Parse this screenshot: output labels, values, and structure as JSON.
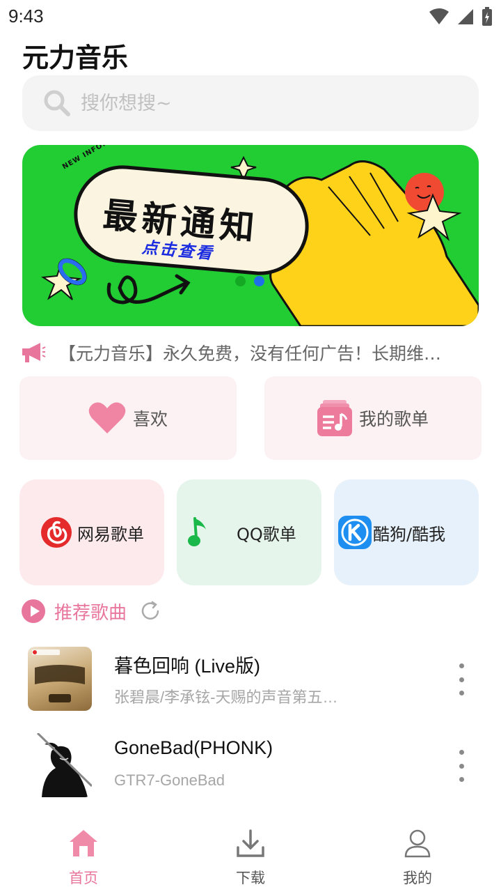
{
  "status_bar": {
    "time": "9:43"
  },
  "app": {
    "title": "元力音乐"
  },
  "search": {
    "placeholder": "搜你想搜~"
  },
  "banner": {
    "tag": "NEW INFORMARTION",
    "title": "最新通知",
    "subtitle": "点击查看",
    "dots": 2,
    "active_dot": 2
  },
  "notice": {
    "text": "【元力音乐】永久免费，没有任何广告！长期维…"
  },
  "quick_cards": [
    {
      "label": "喜欢",
      "icon": "heart-icon"
    },
    {
      "label": "我的歌单",
      "icon": "playlist-icon"
    }
  ],
  "platform_cards": [
    {
      "label": "网易歌单",
      "icon": "netease-icon",
      "bg": "#fdeaed"
    },
    {
      "label": "QQ歌单",
      "icon": "qq-music-icon",
      "bg": "#e6f5ec"
    },
    {
      "label": "酷狗/酷我",
      "icon": "kugou-icon",
      "bg": "#e7f1fb"
    }
  ],
  "recommend": {
    "title": "推荐歌曲"
  },
  "songs": [
    {
      "title": "暮色回响 (Live版)",
      "subtitle": "张碧晨/李承铉-天赐的声音第五…",
      "cover_text": "天赐的声音"
    },
    {
      "title": "GoneBad(PHONK)",
      "subtitle": "GTR7-GoneBad"
    }
  ],
  "bottom_nav": [
    {
      "label": "首页",
      "icon": "home-icon",
      "active": true
    },
    {
      "label": "下载",
      "icon": "download-icon",
      "active": false
    },
    {
      "label": "我的",
      "icon": "profile-icon",
      "active": false
    }
  ],
  "colors": {
    "accent": "#e8769c",
    "banner_bg": "#22cc33",
    "card_bg": "#fcf1f3"
  }
}
